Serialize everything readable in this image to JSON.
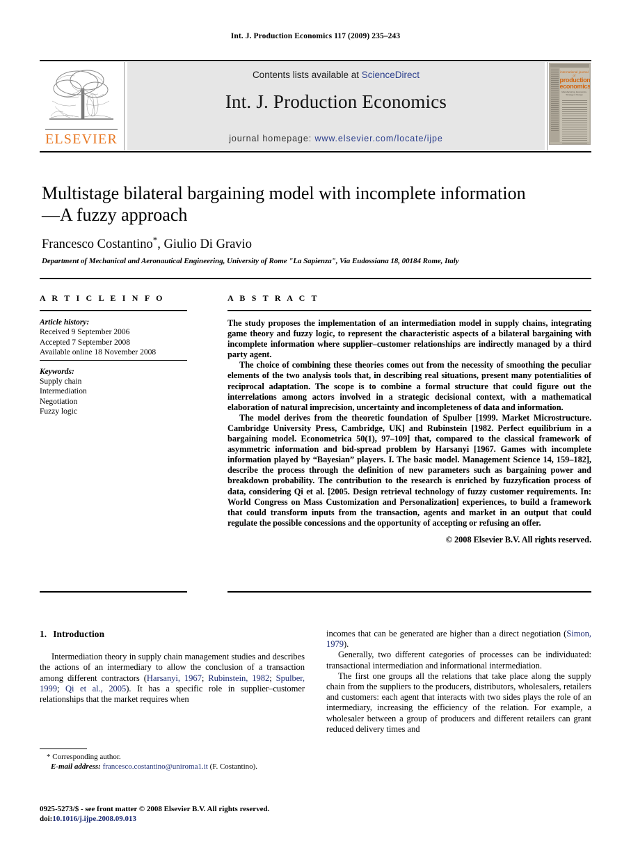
{
  "running_head": "Int. J. Production Economics 117 (2009) 235–243",
  "masthead": {
    "publisher_wordmark": "ELSEVIER",
    "contents_prefix": "Contents lists available at ",
    "contents_link": "ScienceDirect",
    "journal_title": "Int. J. Production Economics",
    "homepage_prefix": "journal homepage: ",
    "homepage_url": "www.elsevier.com/locate/ijpe",
    "cover": {
      "line1": "international journal of",
      "line2": "production",
      "line3": "economics",
      "line4": "Manufacturing, Economics, Strategy & Design"
    }
  },
  "article": {
    "title": "Multistage bilateral bargaining model with incomplete information—A fuzzy approach",
    "authors": "Francesco Costantino",
    "authors_tail": ", Giulio Di Gravio",
    "author_marker": "*",
    "affiliation": "Department of Mechanical and Aeronautical Engineering, University of Rome \"La Sapienza\", Via Eudossiana 18, 00184 Rome, Italy"
  },
  "info": {
    "heading": "A R T I C L E   I N F O",
    "history_label": "Article history:",
    "history": [
      "Received 9 September 2006",
      "Accepted 7 September 2008",
      "Available online 18 November 2008"
    ],
    "keywords_label": "Keywords:",
    "keywords": [
      "Supply chain",
      "Intermediation",
      "Negotiation",
      "Fuzzy logic"
    ]
  },
  "abstract": {
    "heading": "A B S T R A C T",
    "paragraphs": [
      "The study proposes the implementation of an intermediation model in supply chains, integrating game theory and fuzzy logic, to represent the characteristic aspects of a bilateral bargaining with incomplete information where supplier–customer relationships are indirectly managed by a third party agent.",
      "The choice of combining these theories comes out from the necessity of smoothing the peculiar elements of the two analysis tools that, in describing real situations, present many potentialities of reciprocal adaptation. The scope is to combine a formal structure that could figure out the interrelations among actors involved in a strategic decisional context, with a mathematical elaboration of natural imprecision, uncertainty and incompleteness of data and information.",
      "The model derives from the theoretic foundation of Spulber [1999. Market Microstructure. Cambridge University Press, Cambridge, UK] and Rubinstein [1982. Perfect equilibrium in a bargaining model. Econometrica 50(1), 97–109] that, compared to the classical framework of asymmetric information and bid-spread problem by Harsanyi [1967. Games with incomplete information played by “Bayesian” players. I. The basic model. Management Science 14, 159–182], describe the process through the definition of new parameters such as bargaining power and breakdown probability. The contribution to the research is enriched by fuzzyfication process of data, considering Qi et al. [2005. Design retrieval technology of fuzzy customer requirements. In: World Congress on Mass Customization and Personalization] experiences, to build a framework that could transform inputs from the transaction, agents and market in an output that could regulate the possible concessions and the opportunity of accepting or refusing an offer."
    ],
    "copyright": "© 2008 Elsevier B.V. All rights reserved."
  },
  "body": {
    "section_number": "1.",
    "section_title": "Introduction",
    "left_paragraph_lead": "Intermediation theory in supply chain management studies and describes the actions of an intermediary to allow the conclusion of a transaction among different contractors (",
    "left_citations": [
      "Harsanyi, 1967",
      "Rubinstein, 1982",
      "Spulber, 1999",
      "Qi et al., 2005"
    ],
    "left_paragraph_tail": "). It has a specific role in supplier–customer relationships that the market requires when",
    "right_paragraph_1_lead": "incomes that can be generated are higher than a direct negotiation (",
    "right_citation_1": "Simon, 1979",
    "right_paragraph_1_tail": ").",
    "right_paragraph_2": "Generally, two different categories of processes can be individuated: transactional intermediation and informational intermediation.",
    "right_paragraph_3": "The first one groups all the relations that take place along the supply chain from the suppliers to the producers, distributors, wholesalers, retailers and customers: each agent that interacts with two sides plays the role of an intermediary, increasing the efficiency of the relation. For example, a wholesaler between a group of producers and different retailers can grant reduced delivery times and"
  },
  "footnotes": {
    "corresponding": "* Corresponding author.",
    "email_label": "E-mail address:",
    "email": "francesco.costantino@uniroma1.it",
    "email_tail": "(F. Costantino).",
    "issn_line": "0925-5273/$ - see front matter © 2008 Elsevier B.V. All rights reserved.",
    "doi_label": "doi:",
    "doi": "10.1016/j.ijpe.2008.09.013"
  },
  "colors": {
    "link": "#1b2a72",
    "sciencedirect": "#2b3e8c",
    "elsevier_orange": "#E87722",
    "band_grey": "#e6e6e6"
  }
}
